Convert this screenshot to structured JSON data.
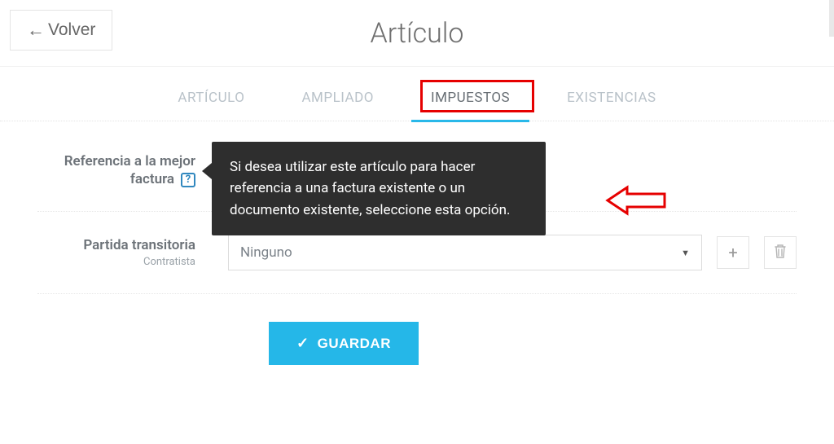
{
  "header": {
    "back_label": "Volver",
    "title": "Artículo"
  },
  "tabs": {
    "items": [
      {
        "label": "ARTÍCULO"
      },
      {
        "label": "AMPLIADO"
      },
      {
        "label": "IMPUESTOS"
      },
      {
        "label": "EXISTENCIAS"
      }
    ]
  },
  "rows": {
    "reference": {
      "label": "Referencia a la mejor factura"
    },
    "partida": {
      "label": "Partida transitoria",
      "sublabel": "Contratista",
      "selected": "Ninguno"
    }
  },
  "tooltip": {
    "text": "Si desea utilizar este artículo para hacer referencia a una factura existente o un documento existente, seleccione esta opción."
  },
  "actions": {
    "save_label": "GUARDAR"
  }
}
